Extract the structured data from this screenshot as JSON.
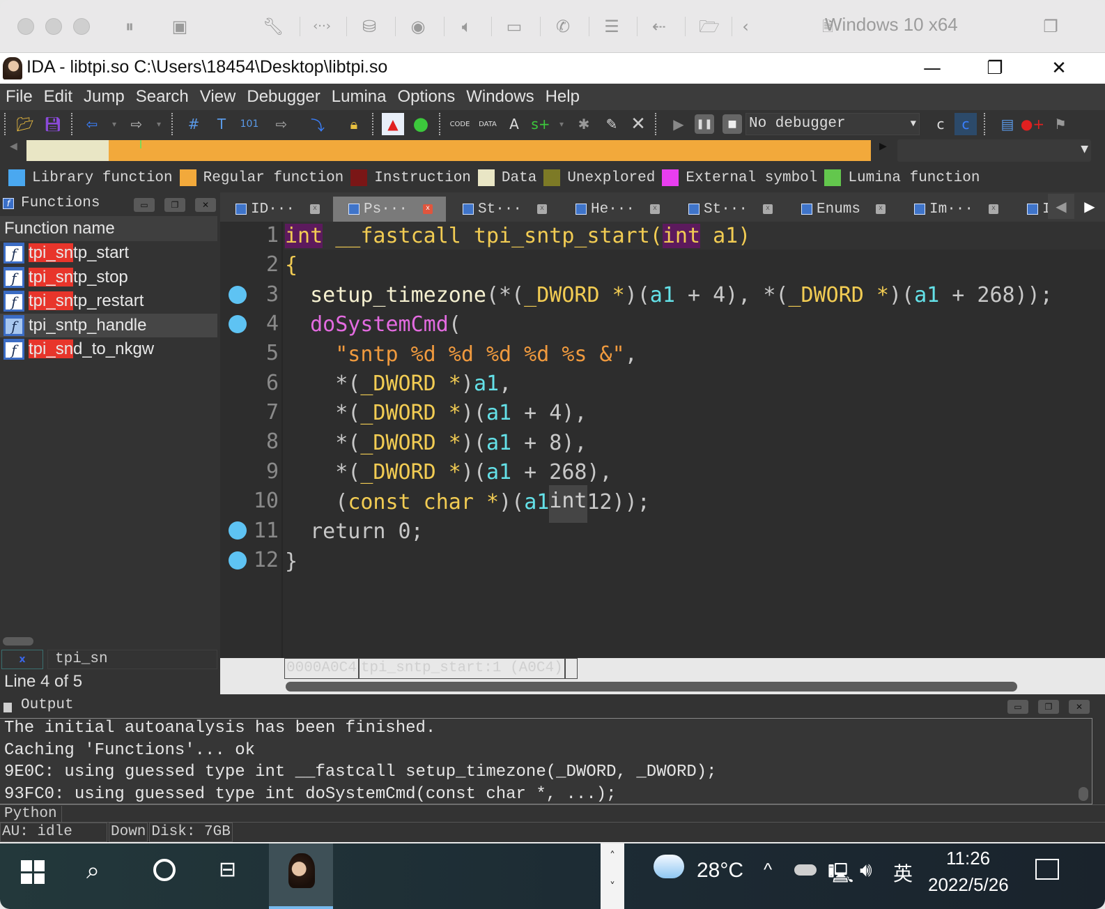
{
  "vm": {
    "title": "Windows 10 x64",
    "toolbar_icons": [
      "pause-icon",
      "snapshot-icon",
      "settings-wrench-icon",
      "network-icon",
      "disk-icon",
      "camera-icon",
      "audio-icon",
      "video-icon",
      "phone-icon",
      "storage-icon",
      "usb-icon",
      "shared-folder-icon",
      "back-icon"
    ]
  },
  "window": {
    "title": "IDA - libtpi.so C:\\Users\\18454\\Desktop\\libtpi.so",
    "minimize": "—",
    "restore": "❐",
    "close": "✕"
  },
  "menu": [
    "File",
    "Edit",
    "Jump",
    "Search",
    "View",
    "Debugger",
    "Lumina",
    "Options",
    "Windows",
    "Help"
  ],
  "toolbar": {
    "debugger_select": "No debugger"
  },
  "legend": [
    {
      "label": "Library function",
      "color": "#4aa8f0"
    },
    {
      "label": "Regular function",
      "color": "#f2a93b"
    },
    {
      "label": "Instruction",
      "color": "#7a1616"
    },
    {
      "label": "Data",
      "color": "#e9e6c5"
    },
    {
      "label": "Unexplored",
      "color": "#7d7a26"
    },
    {
      "label": "External symbol",
      "color": "#e93ef0"
    },
    {
      "label": "Lumina function",
      "color": "#63c74d"
    }
  ],
  "functions": {
    "title": "Functions",
    "column": "Function name",
    "items": [
      {
        "name": "tpi_sntp_start",
        "match": "tpi_sn",
        "rest": "tp_start",
        "selected": false
      },
      {
        "name": "tpi_sntp_stop",
        "match": "tpi_sn",
        "rest": "tp_stop",
        "selected": false
      },
      {
        "name": "tpi_sntp_restart",
        "match": "tpi_sn",
        "rest": "tp_restart",
        "selected": false
      },
      {
        "name": "tpi_sntp_handle",
        "match": "",
        "rest": "tpi_sntp_handle",
        "selected": true
      },
      {
        "name": "tpi_snd_to_nkgw",
        "match": "tpi_sn",
        "rest": "d_to_nkgw",
        "selected": false
      }
    ],
    "search_close": "x",
    "search_value": "tpi_sn",
    "status": "Line 4 of 5"
  },
  "tabs": [
    {
      "label": "ID···",
      "active": false
    },
    {
      "label": "Ps···",
      "active": true
    },
    {
      "label": "St···",
      "active": false
    },
    {
      "label": "He···",
      "active": false
    },
    {
      "label": "St···",
      "active": false
    },
    {
      "label": "Enums",
      "active": false
    },
    {
      "label": "Im···",
      "active": false
    },
    {
      "label": "I",
      "active": false
    }
  ],
  "code": {
    "line_numbers": [
      "1",
      "2",
      "3",
      "4",
      "5",
      "6",
      "7",
      "8",
      "9",
      "10",
      "11",
      "12"
    ],
    "breakpoint_lines": [
      3,
      4,
      11,
      12
    ],
    "l1": {
      "t1": "int",
      "t2": " __fastcall tpi_sntp_start(",
      "t3": "int",
      "t4": " a1)"
    },
    "l2": "{",
    "l3": {
      "fn": "  setup_timezone",
      "a": "(*(",
      "b": "_DWORD *",
      "c": ")(",
      "v": "a1",
      "d": " + 4), *(",
      "e": "_DWORD *",
      "f": ")(",
      "v2": "a1",
      "g": " + 268));"
    },
    "l4": {
      "fn": "  doSystemCmd",
      "a": "("
    },
    "l5": {
      "s": "    \"sntp %d %d %d %d %s &\"",
      "a": ","
    },
    "l6": {
      "a": "    *(",
      "b": "_DWORD *",
      "c": ")",
      "v": "a1",
      "d": ","
    },
    "l7": {
      "a": "    *(",
      "b": "_DWORD *",
      "c": ")(",
      "v": "a1",
      "d": " + 4),"
    },
    "l8": {
      "a": "    *(",
      "b": "_DWORD *",
      "c": ")(",
      "v": "a1",
      "d": " + 8),"
    },
    "l9": {
      "a": "    *(",
      "b": "_DWORD *",
      "c": ")(",
      "v": "a1",
      "d": " + 268),"
    },
    "l10": {
      "a": "    (",
      "b": "const char *",
      "c": ")(",
      "v": "a1",
      "tip": "int",
      "d": "12));"
    },
    "l11": "  return 0;",
    "l12": "}"
  },
  "address_bar": {
    "addr": "0000A0C4",
    "loc": "tpi_sntp_start:1 (A0C4)"
  },
  "output": {
    "title": "Output",
    "lines": [
      "The initial autoanalysis has been finished.",
      "Caching 'Functions'... ok",
      "9E0C: using guessed type int __fastcall setup_timezone(_DWORD, _DWORD);",
      "93FC0: using guessed type int doSystemCmd(const char *, ...);"
    ],
    "python_label": "Python"
  },
  "status": {
    "au": "AU:  idle",
    "down": "Down",
    "disk": "Disk: 7GB"
  },
  "taskbar": {
    "weather": "28°C",
    "ime": "英",
    "time": "11:26",
    "date": "2022/5/26"
  }
}
